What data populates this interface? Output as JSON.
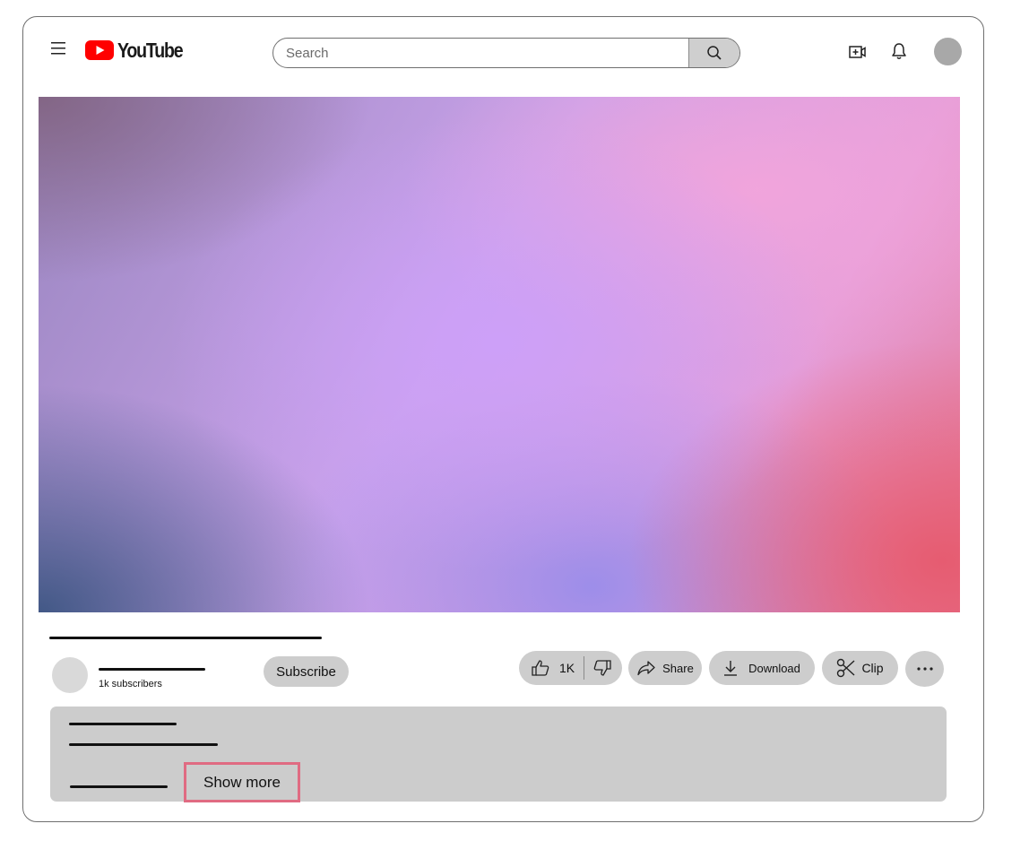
{
  "header": {
    "logo_text": "YouTube",
    "search_placeholder": "Search",
    "icons": [
      "menu-icon",
      "youtube-play-icon",
      "search-icon",
      "create-video-icon",
      "bell-icon",
      "account-avatar"
    ]
  },
  "channel": {
    "subscribers": "1k subscribers",
    "subscribe_label": "Subscribe"
  },
  "actions": {
    "likes": "1K",
    "share_label": "Share",
    "download_label": "Download",
    "clip_label": "Clip"
  },
  "description": {
    "show_more_label": "Show more"
  },
  "colors": {
    "logo_red": "#ff0000",
    "pill_bg": "#cdcdcd",
    "description_bg": "#cccccc",
    "highlight_border": "#e06b82"
  }
}
